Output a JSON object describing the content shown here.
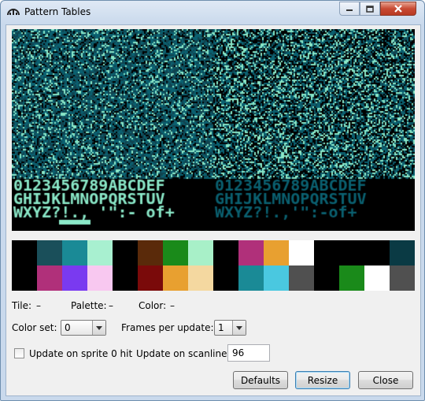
{
  "window": {
    "title": "Pattern Tables"
  },
  "status": {
    "tile_label": "Tile:",
    "tile_value": "–",
    "palette_label": "Palette:",
    "palette_value": "–",
    "color_label": "Color:",
    "color_value": "–"
  },
  "controls": {
    "color_set_label": "Color set:",
    "color_set_value": "0",
    "frames_label": "Frames per update:",
    "frames_value": "1",
    "sprite0_label": "Update on sprite 0 hit",
    "scanline_label": "Update on scanline:",
    "scanline_value": "96"
  },
  "buttons": {
    "defaults": "Defaults",
    "resize": "Resize",
    "close": "Close"
  },
  "palette_colors": [
    "#000000",
    "#1a4f5a",
    "#1a8a96",
    "#a8f0d0",
    "#000000",
    "#5a2a0a",
    "#1a8a1a",
    "#a8f0c8",
    "#000000",
    "#b0307a",
    "#e8a030",
    "#ffffff",
    "#000000",
    "#000000",
    "#000000",
    "#0a3a44",
    "#000000",
    "#b0307a",
    "#7a3af0",
    "#f8c8f0",
    "#000000",
    "#7a0a0a",
    "#e8a030",
    "#f4d8a0",
    "#000000",
    "#1a8a96",
    "#4ac8e0",
    "#505050",
    "#000000",
    "#1a8a1a",
    "#ffffff",
    "#505050"
  ],
  "pattern_colors": [
    "#000000",
    "#0a6070",
    "#8ae8c8",
    "#104450"
  ],
  "font_rows": [
    "0123456789ABCDEF",
    "GHIJKLMNOPQRSTUV",
    "WXYZ?!., '\":- of+"
  ]
}
